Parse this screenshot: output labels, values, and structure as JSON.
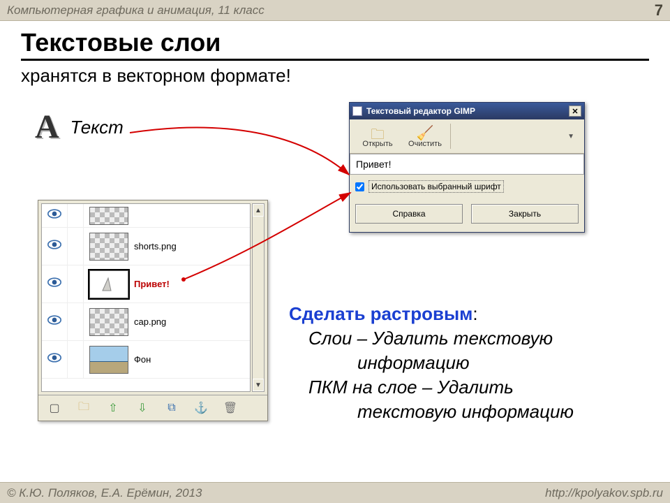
{
  "header": {
    "course": "Компьютерная графика и анимация, 11 класс",
    "page": "7"
  },
  "footer": {
    "copyright": "© К.Ю. Поляков, Е.А. Ерёмин, 2013",
    "url": "http://kpolyakov.spb.ru"
  },
  "title": "Текстовые слои",
  "subtitle": "хранятся в векторном формате!",
  "tool": {
    "glyph": "A",
    "label": "Текст"
  },
  "layers": {
    "items": [
      {
        "name": "shorts.png"
      },
      {
        "name": "Привет!",
        "selected": true
      },
      {
        "name": "cap.png"
      },
      {
        "name": "Фон"
      }
    ],
    "toolbar_icons": [
      "new-layer",
      "folder",
      "up",
      "down",
      "duplicate",
      "anchor",
      "trash"
    ]
  },
  "editor": {
    "title": "Текстовый редактор GIMP",
    "open": "Открыть",
    "clear": "Очистить",
    "text": "Привет!",
    "use_font": "Использовать выбранный шрифт",
    "help": "Справка",
    "close": "Закрыть"
  },
  "right": {
    "hdr": "Сделать растровым",
    "l1a": "Слои – Удалить текстовую",
    "l1b": "информацию",
    "l2a": "ПКМ на слое – Удалить",
    "l2b": "текстовую информацию"
  }
}
